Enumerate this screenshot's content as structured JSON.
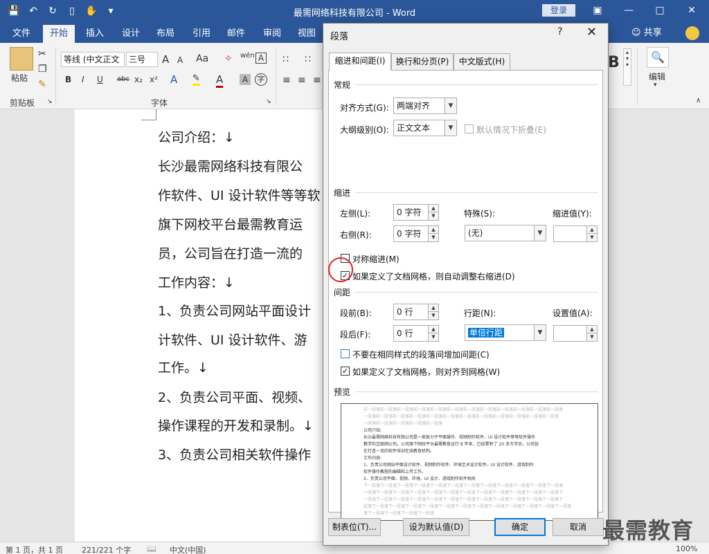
{
  "window": {
    "title": "最需网络科技有限公司  -  Word",
    "login_label": "登录",
    "qat_icons": [
      "save-icon",
      "undo-icon",
      "redo-icon",
      "new-doc-icon",
      "touch-icon",
      "customize-icon"
    ],
    "ctrl_icons": [
      "ribbon-display-icon",
      "minimize-icon",
      "maximize-icon",
      "close-icon"
    ]
  },
  "tabs": [
    "文件",
    "开始",
    "插入",
    "设计",
    "布局",
    "引用",
    "邮件",
    "审阅",
    "视图"
  ],
  "share_label": "共享",
  "ribbon": {
    "paste_label": "粘贴",
    "clipboard_label": "剪贴板",
    "font_group_label": "字体",
    "font_name": "等线 (中文正文",
    "font_size": "三号",
    "edit_label": "编辑",
    "format_buttons": [
      "B",
      "I",
      "U",
      "abc",
      "x₂",
      "x²"
    ],
    "grow_font": "A",
    "shrink_font": "A",
    "change_case": "Aa",
    "phonetic": "wén",
    "border_char": "A"
  },
  "document": {
    "lines": [
      "公司介绍：↓",
      "长沙最需网络科技有限公",
      "作软件、UI 设计软件等等软",
      "旗下网校平台最需教育运",
      "员，公司旨在打造一流的",
      "工作内容：↓",
      "1、负责公司网站平面设计",
      "计软件、UI 设计软件、游",
      "工作。↓",
      "2、负责公司平面、视频、",
      "操作课程的开发和录制。↓",
      "3、负责公司相关软件操作"
    ]
  },
  "statusbar": {
    "page": "第 1 页，共 1 页",
    "words": "221/221 个字",
    "lang": "中文(中国)",
    "zoom": "100%"
  },
  "dialog": {
    "title": "段落",
    "help": "?",
    "tabs": [
      "缩进和间距(I)",
      "换行和分页(P)",
      "中文版式(H)"
    ],
    "general": {
      "title": "常规",
      "align_label": "对齐方式(G):",
      "align_value": "两端对齐",
      "outline_label": "大纲级别(O):",
      "outline_value": "正文文本",
      "collapse_label": "默认情况下折叠(E)"
    },
    "indent": {
      "title": "缩进",
      "left_label": "左侧(L):",
      "left_value": "0 字符",
      "right_label": "右侧(R):",
      "right_value": "0 字符",
      "special_label": "特殊(S):",
      "special_value": "(无)",
      "by_label": "缩进值(Y):",
      "by_value": "",
      "mirror_label": "对称缩进(M)",
      "auto_adjust_label": "如果定义了文档网格，则自动调整右缩进(D)"
    },
    "spacing": {
      "title": "间距",
      "before_label": "段前(B):",
      "before_value": "0 行",
      "after_label": "段后(F):",
      "after_value": "0 行",
      "line_label": "行距(N):",
      "line_value": "单倍行距",
      "at_label": "设置值(A):",
      "at_value": "",
      "no_space_label": "不要在相同样式的段落间增加间距(C)",
      "snap_grid_label": "如果定义了文档网格，则对齐到网格(W)"
    },
    "preview": {
      "title": "预览",
      "ghost_before": [
        "前一段落前一段落前一段落前一段落前一段落前一段落前一段落前一段落前一段落前一段落前一段落前一段落",
        "一段落前一段落前一段落前一段落前一段落前一段落前一段落前一段落前一段落前一段落前一段落前一段落",
        "一段落前一段落前一段落前一段落前一段落"
      ],
      "body": [
        "公司介绍:",
        "长沙最需网络科技有限公司是一家致力于平面操作、视频制作软件、UI 设计软件等等软件操作",
        "教学的互联网公司。公司旗下网校平台最需教育运行 8 年来，已经累积了 20 多万学员，公司旨",
        "在打造一流的软件培训在线教育机构。",
        "工作内容:",
        "1、负责公司网站平面设计软件、视频制作软件、环境艺术设计软件、UI 设计软件、游戏制作",
        "软件操作教程的编辑和上传工作。",
        "2、负责公司平面、视频、环境、UI 设计、游戏制作软件相关"
      ],
      "ghost_after": [
        "下一段落下一段落下一段落下一段落下一段落下一段落下一段落下一段落下一段落下一段落下一段落下一段落",
        "一段落下一段落下一段落下一段落下一段落下一段落下一段落下一段落下一段落下一段落下一段落下一段落下",
        "一段落下一段落下一段落下一段落下一段落下一段落下一段落下一段落下一段落下一段落下一段落下一段落下",
        "段落下一段落下一段落下一段落下一段落下一段落下一段落下一段落下一段落下一段落下一段落下一段落下一段落",
        "落下一段落下一段落下一段落下一段落"
      ]
    },
    "buttons": {
      "tabs": "制表位(T)...",
      "set_default": "设为默认值(D)",
      "ok": "确定",
      "cancel": "取消"
    }
  },
  "watermark": "最需教育",
  "colors": {
    "word_blue": "#2b579a",
    "selection_blue": "#0078d7",
    "highlight_circle": "#e02020"
  }
}
